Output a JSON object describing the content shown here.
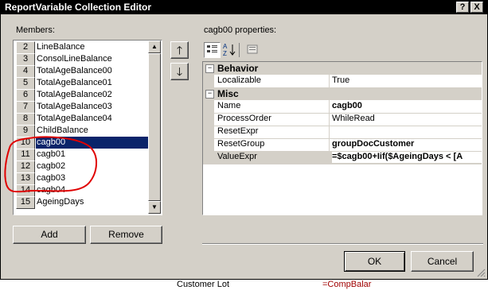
{
  "window": {
    "title": "ReportVariable Collection Editor",
    "help_glyph": "?",
    "close_glyph": "X"
  },
  "members": {
    "label": "Members:",
    "items": [
      {
        "index": "2",
        "name": "LineBalance"
      },
      {
        "index": "3",
        "name": "ConsolLineBalance"
      },
      {
        "index": "4",
        "name": "TotalAgeBalance00"
      },
      {
        "index": "5",
        "name": "TotalAgeBalance01"
      },
      {
        "index": "6",
        "name": "TotalAgeBalance02"
      },
      {
        "index": "7",
        "name": "TotalAgeBalance03"
      },
      {
        "index": "8",
        "name": "TotalAgeBalance04"
      },
      {
        "index": "9",
        "name": "ChildBalance"
      },
      {
        "index": "10",
        "name": "cagb00"
      },
      {
        "index": "11",
        "name": "cagb01"
      },
      {
        "index": "12",
        "name": "cagb02"
      },
      {
        "index": "13",
        "name": "cagb03"
      },
      {
        "index": "14",
        "name": "cagb04"
      },
      {
        "index": "15",
        "name": "AgeingDays"
      }
    ],
    "selected_index": "10",
    "add_label": "Add",
    "remove_label": "Remove"
  },
  "properties": {
    "label": "cagb00 properties:",
    "categories": [
      {
        "name": "Behavior",
        "rows": [
          {
            "name": "Localizable",
            "value": "True",
            "bold": false
          }
        ]
      },
      {
        "name": "Misc",
        "rows": [
          {
            "name": "Name",
            "value": "cagb00",
            "bold": true
          },
          {
            "name": "ProcessOrder",
            "value": "WhileRead",
            "bold": false
          },
          {
            "name": "ResetExpr",
            "value": "",
            "bold": false
          },
          {
            "name": "ResetGroup",
            "value": "groupDocCustomer",
            "bold": true
          },
          {
            "name": "ValueExpr",
            "value": "=$cagb00+Iif($AgeingDays < [A",
            "bold": true
          }
        ]
      }
    ],
    "collapse_glyph": "−"
  },
  "footer": {
    "ok_label": "OK",
    "cancel_label": "Cancel"
  },
  "background": {
    "text1": "Customer Lot",
    "text2": "=CompBalar"
  },
  "annotation_color": "#e00000"
}
